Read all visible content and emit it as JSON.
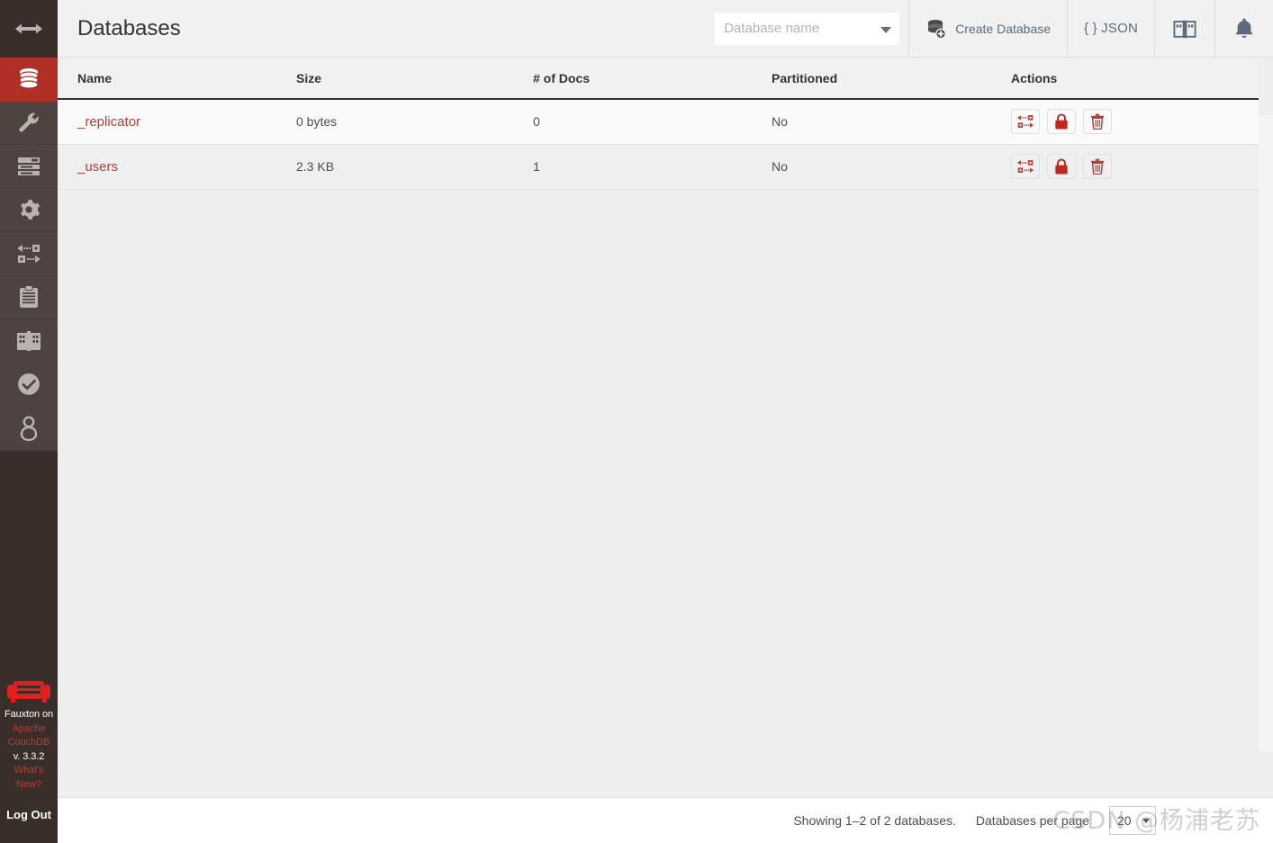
{
  "sidebar": {
    "toggle": {
      "icon": "arrows-horizontal-icon",
      "label": "Toggle sidebar"
    },
    "items": [
      {
        "icon": "database-icon",
        "label": "Databases",
        "active": true
      },
      {
        "icon": "wrench-icon",
        "label": "Setup",
        "active": false
      },
      {
        "icon": "server-bars-icon",
        "label": "Active Tasks",
        "active": false
      },
      {
        "icon": "gear-icon",
        "label": "Configuration",
        "active": false
      },
      {
        "icon": "replication-arrows-icon",
        "label": "Replication",
        "active": false
      },
      {
        "icon": "clipboard-icon",
        "label": "Documentation",
        "active": false
      },
      {
        "icon": "open-book-icon",
        "label": "Docs",
        "active": false
      },
      {
        "icon": "check-circle-icon",
        "label": "Verify",
        "active": false
      },
      {
        "icon": "user-icon",
        "label": "Account",
        "active": false
      }
    ],
    "footer": {
      "logo": "couch-icon",
      "product": "Fauxton on",
      "project_link": "Apache CouchDB",
      "version": "v. 3.3.2",
      "whats_new": "What's New?",
      "logout": "Log Out"
    }
  },
  "header": {
    "title": "Databases",
    "search": {
      "value": "",
      "placeholder": "Database name",
      "icon": "chevron-down-icon"
    },
    "create_database": {
      "label": "Create Database",
      "icon": "database-plus-icon"
    },
    "json": {
      "label": "{ } JSON"
    },
    "docs_icon": "open-book-icon",
    "notifications_icon": "bell-icon"
  },
  "table": {
    "columns": [
      "Name",
      "Size",
      "# of Docs",
      "Partitioned",
      "Actions"
    ],
    "rows": [
      {
        "name": "_replicator",
        "size": "0 bytes",
        "docs": "0",
        "partitioned": "No",
        "actions": [
          "replicate-icon",
          "permissions-lock-icon",
          "delete-trash-icon"
        ]
      },
      {
        "name": "_users",
        "size": "2.3 KB",
        "docs": "1",
        "partitioned": "No",
        "actions": [
          "replicate-icon",
          "permissions-lock-icon",
          "delete-trash-icon"
        ]
      }
    ]
  },
  "footer": {
    "showing": "Showing 1–2 of 2 databases.",
    "per_page_label": "Databases per page",
    "per_page_value": "20"
  },
  "watermark": {
    "text": "CSDN @杨浦老苏"
  },
  "colors": {
    "sidebar_bg": "#3a2e2b",
    "sidebar_item_bg": "#4e4340",
    "accent_red": "#b02f27",
    "link_red": "#b0413e",
    "header_bg": "#f1f1f1",
    "page_bg": "#eeeeee",
    "row_odd_bg": "#fafafa",
    "row_even_bg": "#efefef",
    "icon_blue_gray": "#5c6b7a"
  }
}
